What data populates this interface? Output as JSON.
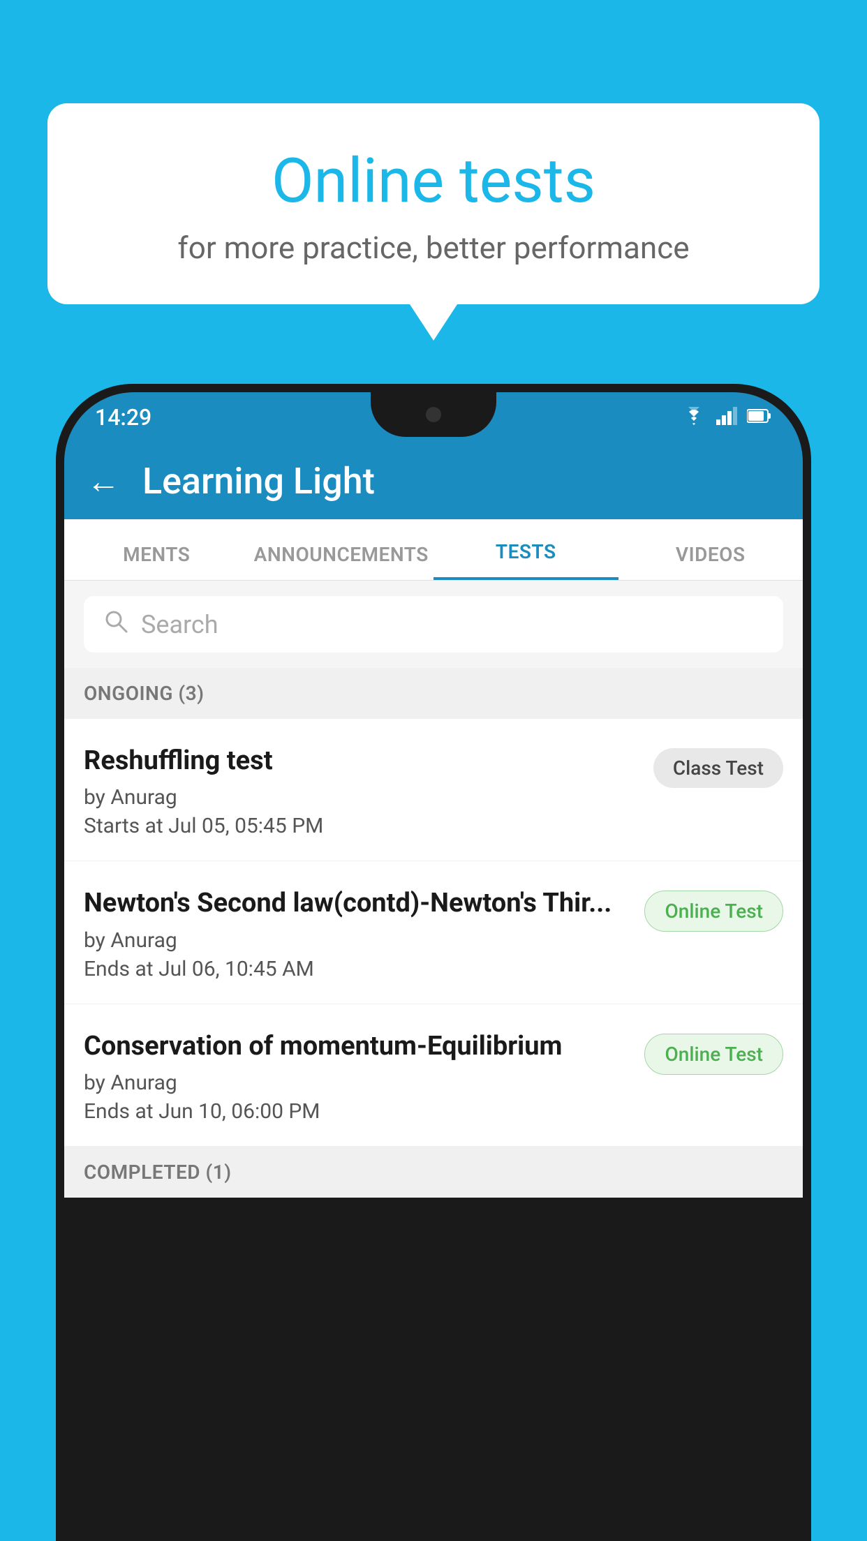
{
  "background": {
    "color": "#1ab7e8"
  },
  "bubble": {
    "title": "Online tests",
    "subtitle": "for more practice, better performance"
  },
  "statusBar": {
    "time": "14:29",
    "wifiIcon": "▼",
    "signalIcon": "◀",
    "batteryIcon": "▮"
  },
  "header": {
    "title": "Learning Light",
    "backLabel": "←"
  },
  "tabs": [
    {
      "label": "MENTS",
      "active": false
    },
    {
      "label": "ANNOUNCEMENTS",
      "active": false
    },
    {
      "label": "TESTS",
      "active": true
    },
    {
      "label": "VIDEOS",
      "active": false
    }
  ],
  "search": {
    "placeholder": "Search"
  },
  "sections": [
    {
      "title": "ONGOING (3)",
      "tests": [
        {
          "name": "Reshuffling test",
          "author": "by Anurag",
          "timeLabel": "Starts at",
          "time": "Jul 05, 05:45 PM",
          "badgeText": "Class Test",
          "badgeType": "class"
        },
        {
          "name": "Newton's Second law(contd)-Newton's Thir...",
          "author": "by Anurag",
          "timeLabel": "Ends at",
          "time": "Jul 06, 10:45 AM",
          "badgeText": "Online Test",
          "badgeType": "online"
        },
        {
          "name": "Conservation of momentum-Equilibrium",
          "author": "by Anurag",
          "timeLabel": "Ends at",
          "time": "Jun 10, 06:00 PM",
          "badgeText": "Online Test",
          "badgeType": "online"
        }
      ]
    }
  ],
  "completedSection": {
    "title": "COMPLETED (1)"
  }
}
